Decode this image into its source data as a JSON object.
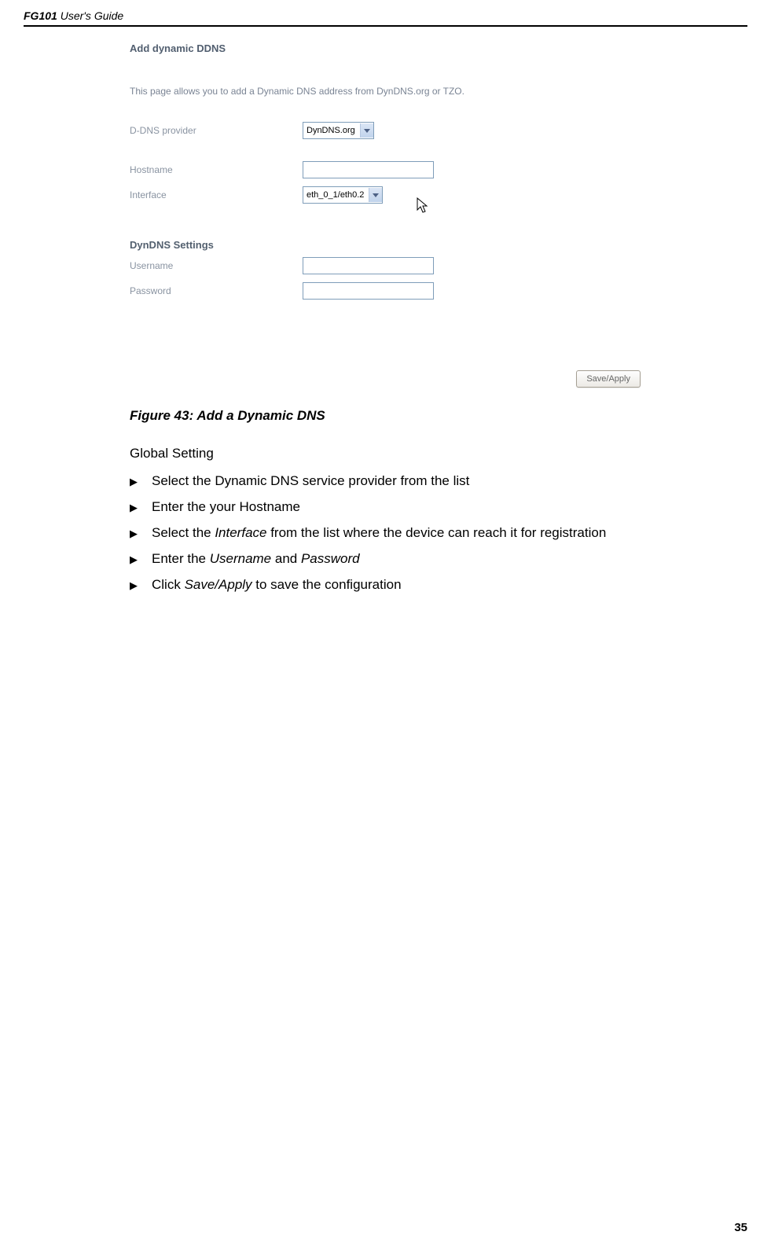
{
  "header": {
    "bold_part": "FG101",
    "rest": " User's Guide"
  },
  "screenshot": {
    "title": "Add dynamic DDNS",
    "description": "This page allows you to add a Dynamic DNS address from DynDNS.org or TZO.",
    "provider_label": "D-DNS provider",
    "provider_value": "DynDNS.org",
    "hostname_label": "Hostname",
    "interface_label": "Interface",
    "interface_value": "eth_0_1/eth0.2",
    "section": "DynDNS Settings",
    "username_label": "Username",
    "password_label": "Password",
    "button": "Save/Apply"
  },
  "figure_caption": "Figure 43: Add a Dynamic DNS",
  "global_setting": "Global Setting",
  "bullets": [
    {
      "pre": "Select the Dynamic DNS service provider from the list"
    },
    {
      "pre": "Enter the your Hostname"
    },
    {
      "pre": "Select the ",
      "it1": "Interface",
      "post": " from the list where the device can reach it for registration"
    },
    {
      "pre": "Enter the ",
      "it1": "Username",
      "mid": " and ",
      "it2": "Password"
    },
    {
      "pre": "Click ",
      "it1": "Save/Apply",
      "post": " to save the configuration"
    }
  ],
  "page_number": "35"
}
